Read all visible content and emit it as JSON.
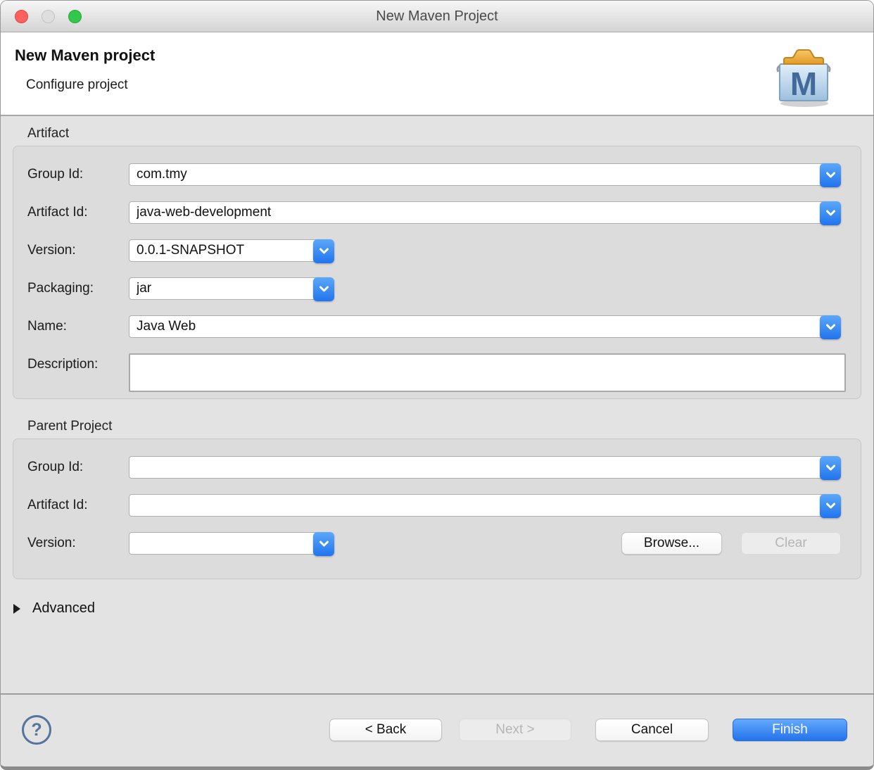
{
  "window": {
    "title": "New Maven Project"
  },
  "header": {
    "title": "New Maven project",
    "subtitle": "Configure project",
    "icon_letter": "M"
  },
  "artifact": {
    "legend": "Artifact",
    "group_id": {
      "label": "Group Id:",
      "value": "com.tmy"
    },
    "artifact_id": {
      "label": "Artifact Id:",
      "value": "java-web-development"
    },
    "version": {
      "label": "Version:",
      "value": "0.0.1-SNAPSHOT"
    },
    "packaging": {
      "label": "Packaging:",
      "value": "jar"
    },
    "name": {
      "label": "Name:",
      "value": "Java Web"
    },
    "description": {
      "label": "Description:",
      "value": ""
    }
  },
  "parent_project": {
    "legend": "Parent Project",
    "group_id": {
      "label": "Group Id:",
      "value": ""
    },
    "artifact_id": {
      "label": "Artifact Id:",
      "value": ""
    },
    "version": {
      "label": "Version:",
      "value": ""
    },
    "browse_label": "Browse...",
    "clear_label": "Clear",
    "clear_enabled": false
  },
  "advanced": {
    "label": "Advanced",
    "expanded": false
  },
  "footer": {
    "help_label": "?",
    "buttons": {
      "back": "< Back",
      "next": "Next >",
      "cancel": "Cancel",
      "finish": "Finish"
    },
    "next_enabled": false
  },
  "colors": {
    "accent_blue": "#2373ec",
    "combo_button_top": "#5ba8f9",
    "combo_button_bottom": "#2174ee",
    "window_bg": "#e3e3e3",
    "group_box_bg": "#dcdcdc",
    "traffic_red": "#fc615d",
    "traffic_minimize_disabled": "#dedede",
    "traffic_green": "#32c84b",
    "maven_lid_orange": "#f0b14a",
    "maven_body_blue": "#b9d4ea"
  },
  "icons": {
    "combo_chevron": "chevron-down",
    "disclosure": "triangle-right",
    "help": "question-mark-circle",
    "maven_logo": "maven-toolbox"
  }
}
